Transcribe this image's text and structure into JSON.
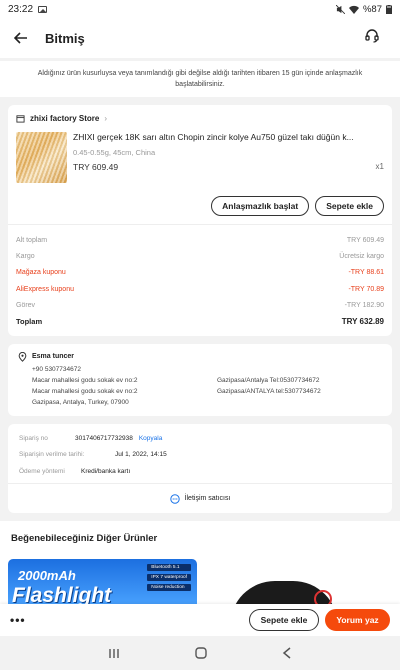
{
  "status_bar": {
    "time": "23:22",
    "battery": "%87"
  },
  "header": {
    "title": "Bitmiş"
  },
  "notice": "Aldığınız ürün kusurluysa veya tanımlandığı gibi değilse aldığı tarihten itibaren 15 gün içinde anlaşmazlık başlatabilirsiniz.",
  "store": {
    "name": "zhixi factory Store",
    "product_name": "ZHIXI gerçek 18K sarı altın Chopin zincir kolye Au750 güzel takı düğün k...",
    "spec": "0.45-0.55g, 45cm, China",
    "price": "TRY 609.49",
    "qty": "x1",
    "dispute_label": "Anlaşmazlık başlat",
    "add_to_cart_label": "Sepete ekle"
  },
  "summary": {
    "rows": [
      {
        "label": "Alt toplam",
        "value": "TRY 609.49"
      },
      {
        "label": "Kargo",
        "value": "Ücretsiz kargo"
      },
      {
        "label": "Mağaza kuponu",
        "value": "-TRY 88.61"
      },
      {
        "label": "AliExpress kuponu",
        "value": "-TRY 70.89"
      },
      {
        "label": "Görev",
        "value": "-TRY 182.90"
      }
    ],
    "total_label": "Toplam",
    "total_value": "TRY 632.89"
  },
  "address": {
    "name": "Esma tuncer",
    "phone": "+90 5307734672",
    "line1_left": "Macar mahallesi godu sokak ev no:2",
    "line1_right": "Gazipasa/Antalya Tel:05307734672",
    "line2_left": "Macar mahallesi godu sokak  ev no:2",
    "line2_right": "Gazipasa/ANTALYA  tel:5307734672",
    "line3": "Gazipasa, Antalya, Turkey, 07900"
  },
  "order": {
    "order_no_label": "Sipariş no",
    "order_no": "3017406717732938",
    "copy_label": "Kopyala",
    "date_label": "Siparişin verilme tarihi:",
    "date": "Jul 1, 2022, 14:15",
    "payment_label": "Ödeme yöntemi",
    "payment": "Kredi/banka kartı",
    "contact_label": "İletişim satıcısı"
  },
  "recommendations": {
    "title": "Beğenebileceğiniz Diğer Ürünler",
    "item1_capacity": "2000mAh",
    "item1_title": "Flashlight",
    "item1_tags": [
      "Bluetooth 5.1",
      "IPX 7 waterproof",
      "Noise reduction"
    ]
  },
  "bottom_bar": {
    "more": "•••",
    "add_to_cart_label": "Sepete ekle",
    "review_label": "Yorum yaz"
  },
  "colors": {
    "accent": "#f54a0c",
    "coupon_red": "#e8401c",
    "link_blue": "#1a73e8"
  }
}
